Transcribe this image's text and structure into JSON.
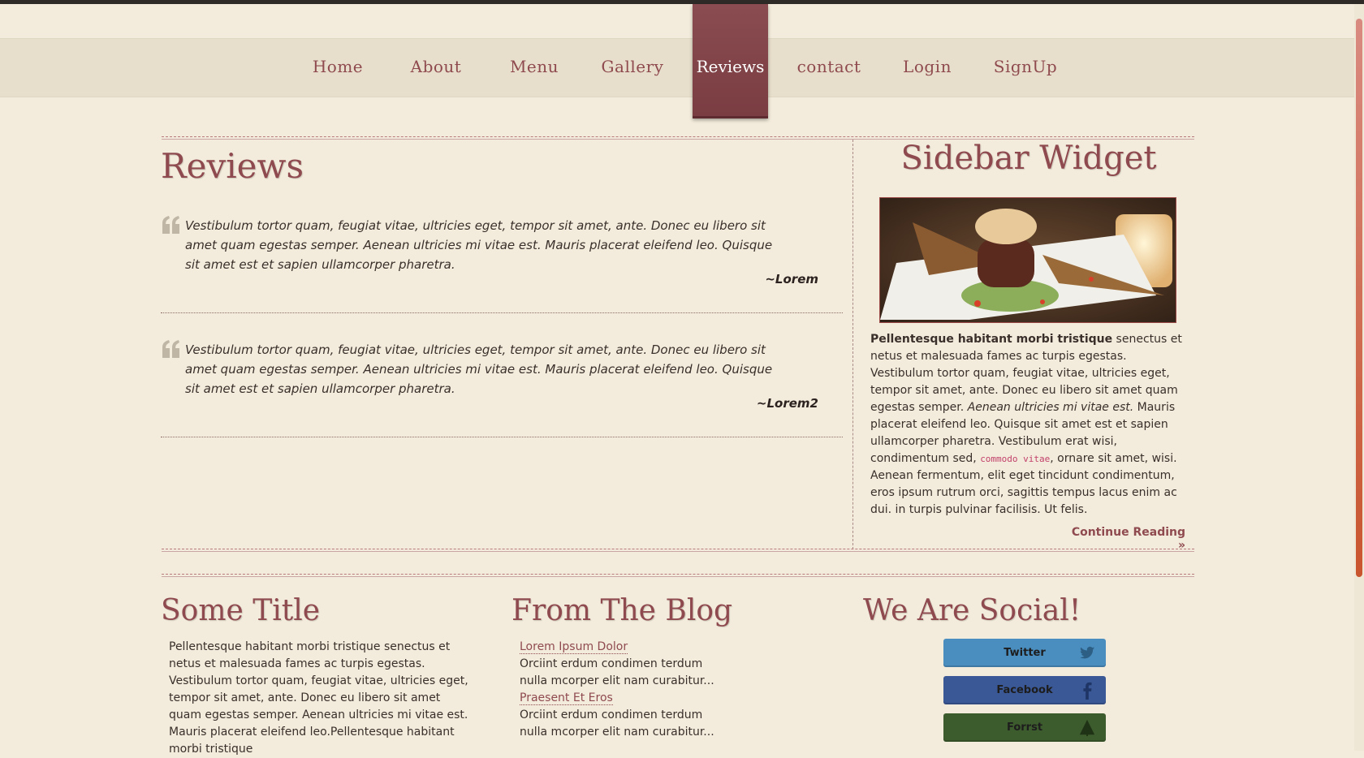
{
  "nav": {
    "items": [
      {
        "label": "Home"
      },
      {
        "label": "About"
      },
      {
        "label": "Menu"
      },
      {
        "label": "Gallery"
      },
      {
        "label": "Reviews"
      },
      {
        "label": "contact"
      },
      {
        "label": "Login"
      },
      {
        "label": "SignUp"
      }
    ],
    "active": "Reviews"
  },
  "main": {
    "title": "Reviews",
    "reviews": [
      {
        "text": "Vestibulum tortor quam, feugiat vitae, ultricies eget, tempor sit amet, ante. Donec eu libero sit amet quam egestas semper. Aenean ultricies mi vitae est. Mauris placerat eleifend leo. Quisque sit amet est et sapien ullamcorper pharetra.",
        "author": "~Lorem"
      },
      {
        "text": "Vestibulum tortor quam, feugiat vitae, ultricies eget, tempor sit amet, ante. Donec eu libero sit amet quam egestas semper. Aenean ultricies mi vitae est. Mauris placerat eleifend leo. Quisque sit amet est et sapien ullamcorper pharetra.",
        "author": "~Lorem2"
      }
    ]
  },
  "sidebar": {
    "title": "Sidebar Widget",
    "text_bold": "Pellentesque habitant morbi tristique",
    "text_1": " senectus et netus et malesuada fames ac turpis egestas. Vestibulum tortor quam, feugiat vitae, ultricies eget, tempor sit amet, ante. Donec eu libero sit amet quam egestas semper. ",
    "text_italic": "Aenean ultricies mi vitae est.",
    "text_2": " Mauris placerat eleifend leo. Quisque sit amet est et sapien ullamcorper pharetra. Vestibulum erat wisi, condimentum sed, ",
    "text_code": "commodo vitae",
    "text_3": ", ornare sit amet, wisi. Aenean fermentum, elit eget tincidunt condimentum, eros ipsum rutrum orci, sagittis tempus lacus enim ac dui. in turpis pulvinar facilisis. Ut felis.",
    "continue_label": "Continue Reading »"
  },
  "footer": {
    "col1": {
      "title": "Some Title",
      "text": "Pellentesque habitant morbi tristique senectus et netus et malesuada fames ac turpis egestas. Vestibulum tortor quam, feugiat vitae, ultricies eget, tempor sit amet, ante. Donec eu libero sit amet quam egestas semper. Aenean ultricies mi vitae est. Mauris placerat eleifend leo.Pellentesque habitant morbi tristique"
    },
    "col2": {
      "title": "From The Blog",
      "posts": [
        {
          "title": "Lorem Ipsum Dolor",
          "excerpt": "Orciint erdum condimen terdum nulla mcorper elit nam curabitur..."
        },
        {
          "title": "Praesent Et Eros",
          "excerpt": "Orciint erdum condimen terdum nulla mcorper elit nam curabitur..."
        }
      ]
    },
    "col3": {
      "title": "We Are Social!",
      "buttons": [
        {
          "label": "Twitter",
          "color": "#4a8ec0"
        },
        {
          "label": "Facebook",
          "color": "#3a5896"
        },
        {
          "label": "Forrst",
          "color": "#3d5c2d"
        }
      ]
    }
  },
  "colors": {
    "accent": "#8f4a4f",
    "background": "#f3ecdc",
    "nav_active": "#7e4247"
  }
}
